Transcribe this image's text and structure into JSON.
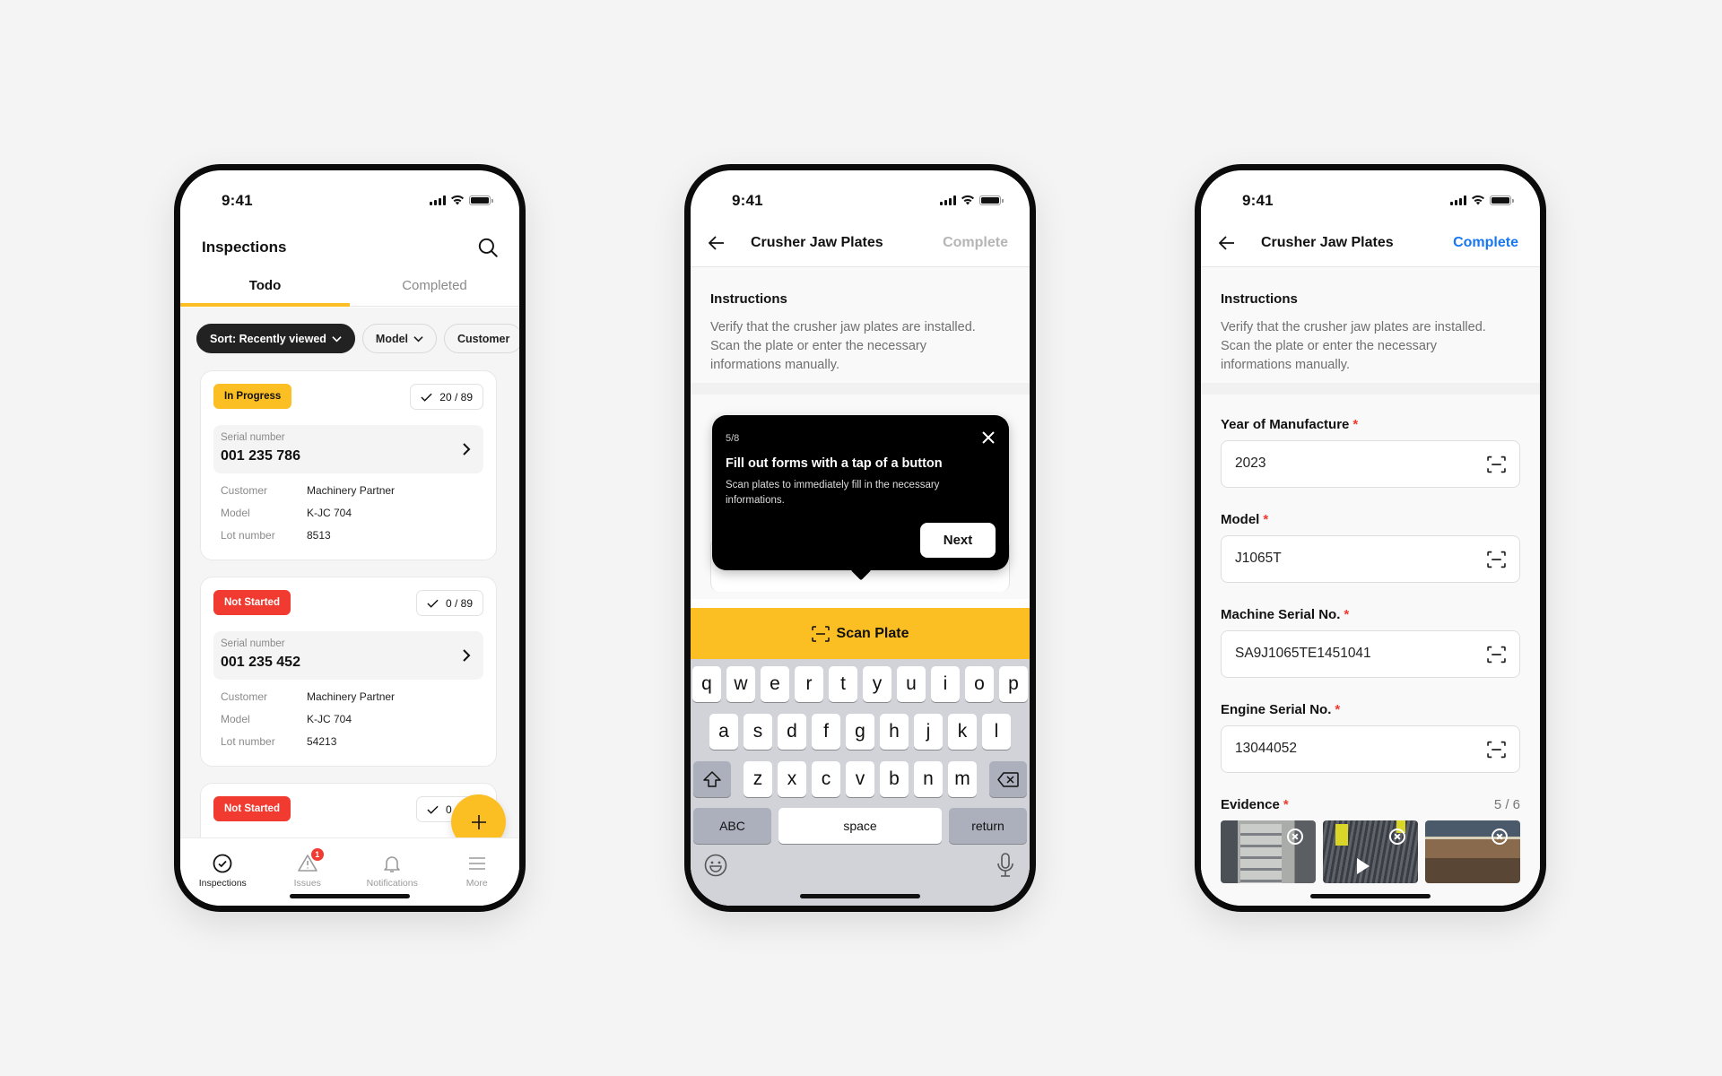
{
  "status_bar": {
    "time": "9:41"
  },
  "phone1": {
    "header": {
      "title": "Inspections"
    },
    "tabs": [
      {
        "label": "Todo",
        "active": true
      },
      {
        "label": "Completed",
        "active": false
      }
    ],
    "chips": [
      {
        "label": "Sort: Recently viewed",
        "selected": true
      },
      {
        "label": "Model",
        "selected": false
      },
      {
        "label": "Customer",
        "selected": false
      }
    ],
    "cards": [
      {
        "status": "In Progress",
        "status_color": "#fbbf24",
        "progress": "20 / 89",
        "serial_label": "Serial number",
        "serial": "001 235 786",
        "rows": [
          {
            "k": "Customer",
            "v": "Machinery Partner"
          },
          {
            "k": "Model",
            "v": "K-JC 704"
          },
          {
            "k": "Lot number",
            "v": "8513"
          }
        ]
      },
      {
        "status": "Not Started",
        "status_color": "#f13a30",
        "progress": "0 / 89",
        "serial_label": "Serial number",
        "serial": "001 235 452",
        "rows": [
          {
            "k": "Customer",
            "v": "Machinery Partner"
          },
          {
            "k": "Model",
            "v": "K-JC 704"
          },
          {
            "k": "Lot number",
            "v": "54213"
          }
        ]
      },
      {
        "status": "Not Started",
        "status_color": "#f13a30",
        "progress": "0 / 89"
      }
    ],
    "fab_icon": "plus-icon",
    "bottom_nav": [
      {
        "label": "Inspections",
        "icon": "check-circle-icon",
        "active": true
      },
      {
        "label": "Issues",
        "icon": "warning-icon",
        "badge": "1"
      },
      {
        "label": "Notifications",
        "icon": "bell-icon"
      },
      {
        "label": "More",
        "icon": "menu-icon"
      }
    ]
  },
  "phone2": {
    "title": "Crusher Jaw Plates",
    "complete_label": "Complete",
    "instructions_title": "Instructions",
    "instructions_text": "Verify that the crusher jaw plates are installed. Scan the plate or enter the necessary informations manually.",
    "tooltip": {
      "step": "5/8",
      "title": "Fill out forms with a tap of a button",
      "description": "Scan plates to immediately fill in the necessary informations.",
      "next_label": "Next"
    },
    "scan_button_label": "Scan Plate",
    "keyboard": {
      "row1": [
        "q",
        "w",
        "e",
        "r",
        "t",
        "y",
        "u",
        "i",
        "o",
        "p"
      ],
      "row2": [
        "a",
        "s",
        "d",
        "f",
        "g",
        "h",
        "j",
        "k",
        "l"
      ],
      "row3": [
        "z",
        "x",
        "c",
        "v",
        "b",
        "n",
        "m"
      ],
      "abc_label": "ABC",
      "space_label": "space",
      "return_label": "return"
    }
  },
  "phone3": {
    "title": "Crusher Jaw Plates",
    "complete_label": "Complete",
    "accent_color": "#1877f2",
    "instructions_title": "Instructions",
    "instructions_text": "Verify that the crusher jaw plates are installed. Scan the plate or enter the necessary informations manually.",
    "fields": [
      {
        "label": "Year of Manufacture",
        "value": "2023",
        "required": "*"
      },
      {
        "label": "Model",
        "value": "J1065T",
        "required": "*"
      },
      {
        "label": "Machine Serial No.",
        "value": "SA9J1065TE1451041",
        "required": "*"
      },
      {
        "label": "Engine Serial No.",
        "value": "13044052",
        "required": "*"
      }
    ],
    "evidence": {
      "label": "Evidence",
      "required": "*",
      "count": "5 / 6"
    }
  }
}
